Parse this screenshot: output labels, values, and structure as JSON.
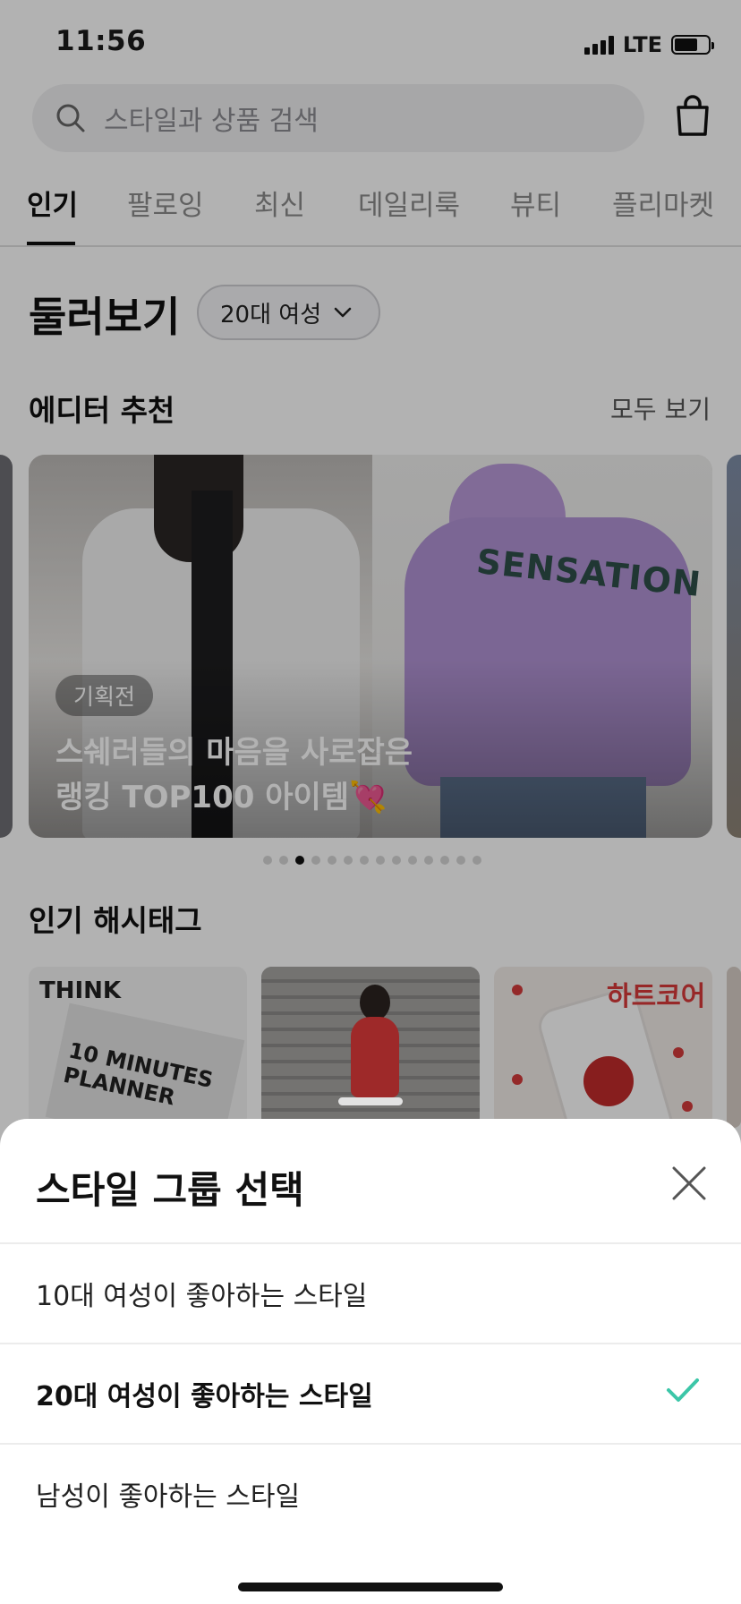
{
  "status_bar": {
    "time": "11:56",
    "network": "LTE"
  },
  "search": {
    "placeholder": "스타일과 상품 검색"
  },
  "tabs": [
    {
      "label": "인기",
      "active": true
    },
    {
      "label": "팔로잉"
    },
    {
      "label": "최신"
    },
    {
      "label": "데일리룩"
    },
    {
      "label": "뷰티"
    },
    {
      "label": "플리마켓"
    }
  ],
  "explore": {
    "title": "둘러보기",
    "group_label": "20대 여성"
  },
  "editor_picks": {
    "title": "에디터 추천",
    "see_all": "모두 보기",
    "card": {
      "photo_text": "SENSATION",
      "tag": "기획전",
      "title_line1": "스쉐러들의 마음을 사로잡은",
      "title_line2": "랭킹 TOP100 아이템",
      "heart": "💘"
    },
    "carousel_active_index": 2,
    "carousel_count": 14
  },
  "hashtags": {
    "title": "인기 해시태그",
    "thumbs": [
      {
        "text1": "THINK",
        "text2": "10 MINUTES PLANNER"
      },
      {
        "text1": ""
      },
      {
        "text1": "하트코어"
      }
    ]
  },
  "sheet": {
    "title": "스타일 그룹 선택",
    "options": [
      {
        "label": "10대 여성이 좋아하는 스타일",
        "selected": false
      },
      {
        "label": "20대 여성이 좋아하는 스타일",
        "selected": true
      },
      {
        "label": "남성이 좋아하는 스타일",
        "selected": false
      }
    ]
  },
  "colors": {
    "accent_check": "#3cc6a8",
    "dim_overlay": "rgba(0,0,0,0.30)"
  },
  "icons": {
    "search": "search-icon",
    "cart": "shopping-bag-icon",
    "chevron": "chevron-down-icon",
    "close": "close-icon",
    "check": "check-icon"
  }
}
